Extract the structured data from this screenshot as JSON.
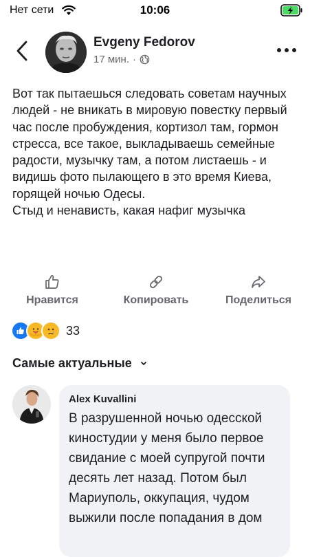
{
  "status_bar": {
    "carrier": "Нет сети",
    "time": "10:06"
  },
  "post": {
    "author": "Evgeny Fedorov",
    "time_ago": "17 мин.",
    "separator": "·",
    "paragraphs": [
      "Вот так пытаешься следовать советам научных людей - не вникать в мировую повестку первый час после пробуждения, кортизол там, гормон стресса, все такое, выкладываешь семейные радости, музычку там, а потом листаешь - и видишь фото пылающего в это время Киева, горящей ночью Одесы.",
      "Стыд и ненависть, какая нафиг музычка"
    ]
  },
  "actions": {
    "like": "Нравится",
    "copy": "Копировать",
    "share": "Поделиться"
  },
  "reactions": {
    "count": "33",
    "icons": [
      "like-reaction",
      "care-reaction",
      "sad-reaction"
    ]
  },
  "comments": {
    "sort_label": "Самые актуальные",
    "items": [
      {
        "author": "Alex Kuvallini",
        "text": "В разрушенной ночью одесской киностудии у меня было первое свидание с моей супругой почти десять лет назад. Потом был Мариуполь, оккупация, чудом выжили после попадания в дом"
      }
    ]
  },
  "colors": {
    "text": "#1c1e21",
    "secondary": "#65676b",
    "like_blue": "#1877f2",
    "reaction_yellow": "#f7b928",
    "battery_green": "#4cd964",
    "bubble_bg": "#f0f2f5"
  }
}
